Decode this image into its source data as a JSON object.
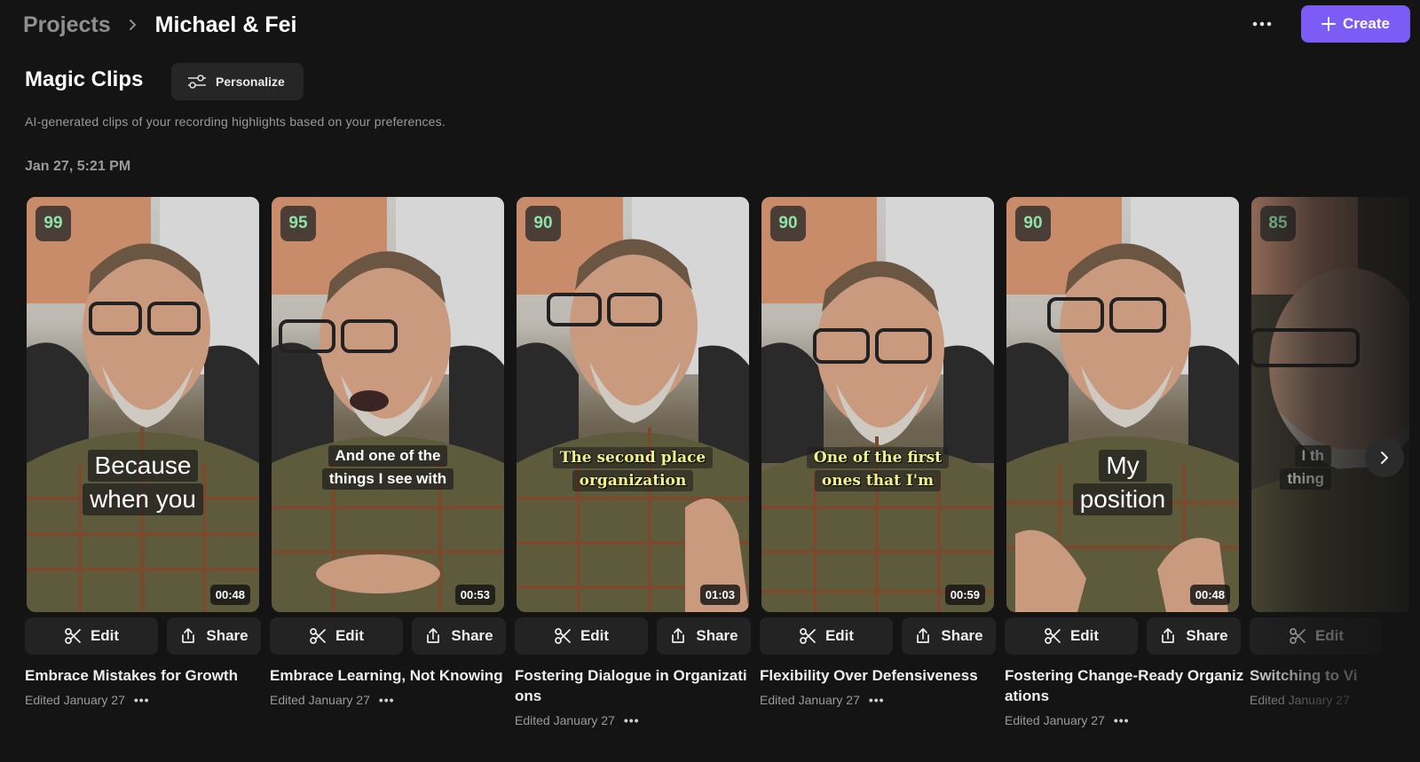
{
  "breadcrumb": {
    "root": "Projects",
    "current": "Michael & Fei"
  },
  "header": {
    "more_icon": "more-horizontal-icon",
    "create_label": "Create"
  },
  "section": {
    "title": "Magic Clips",
    "personalize_label": "Personalize",
    "subtitle": "AI-generated clips of your recording highlights based on your preferences.",
    "date": "Jan 27, 5:21 PM"
  },
  "actions": {
    "edit_label": "Edit",
    "share_label": "Share"
  },
  "colors": {
    "accent": "#7d5cf6",
    "score": "#8fe3a9",
    "serif_caption": "#f4f38a"
  },
  "clips": [
    {
      "score": "99",
      "caption": [
        "Because",
        "when you"
      ],
      "duration": "00:48",
      "title": "Embrace Mistakes for Growth",
      "edited": "Edited January 27"
    },
    {
      "score": "95",
      "caption": [
        "And one of the",
        "things I see with"
      ],
      "duration": "00:53",
      "title": "Embrace Learning, Not Knowing",
      "edited": "Edited January 27"
    },
    {
      "score": "90",
      "caption": [
        "The second place",
        "organization"
      ],
      "duration": "01:03",
      "title": "Fostering Dialogue in Organizations",
      "edited": "Edited January 27"
    },
    {
      "score": "90",
      "caption": [
        "One of the first",
        "ones that I'm"
      ],
      "duration": "00:59",
      "title": "Flexibility Over Defensiveness",
      "edited": "Edited January 27"
    },
    {
      "score": "90",
      "caption": [
        "My",
        "position"
      ],
      "duration": "00:48",
      "title": "Fostering Change-Ready Organizations",
      "edited": "Edited January 27"
    },
    {
      "score": "85",
      "caption": [
        "I th",
        "thing"
      ],
      "title": "Switching to Vi",
      "edited": "Edited January 27"
    }
  ]
}
